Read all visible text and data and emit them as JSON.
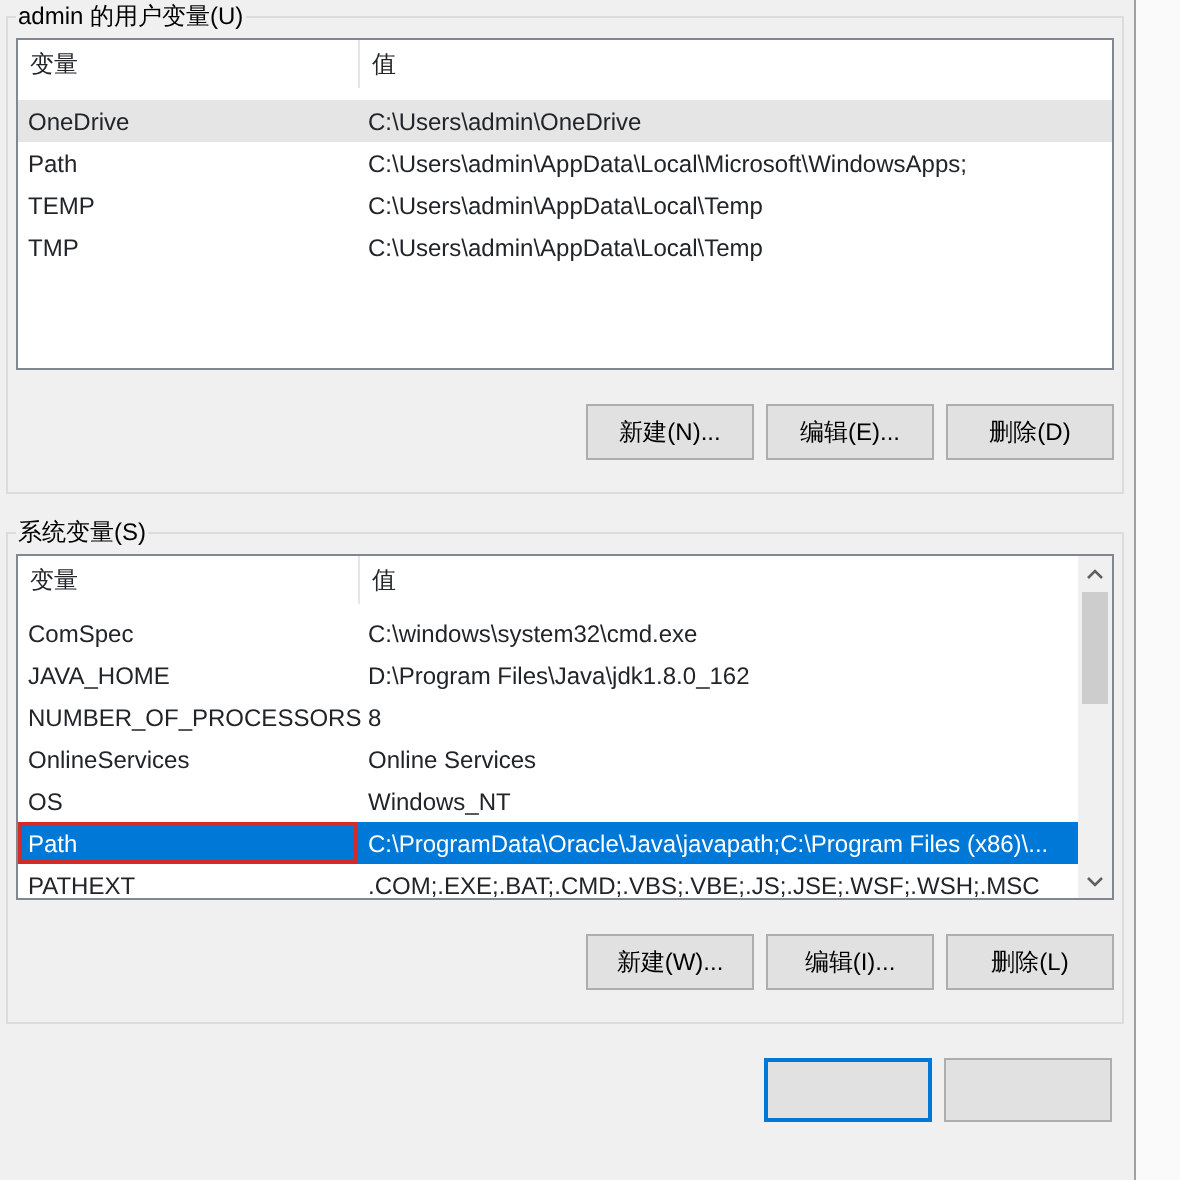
{
  "user_variables": {
    "title": "admin 的用户变量(U)",
    "columns": [
      "变量",
      "值"
    ],
    "rows": [
      {
        "name": "OneDrive",
        "value": "C:\\Users\\admin\\OneDrive",
        "selected": false,
        "hovered": true,
        "highlighted": false
      },
      {
        "name": "Path",
        "value": "C:\\Users\\admin\\AppData\\Local\\Microsoft\\WindowsApps;",
        "selected": false,
        "hovered": false,
        "highlighted": false
      },
      {
        "name": "TEMP",
        "value": "C:\\Users\\admin\\AppData\\Local\\Temp",
        "selected": false,
        "hovered": false,
        "highlighted": false
      },
      {
        "name": "TMP",
        "value": "C:\\Users\\admin\\AppData\\Local\\Temp",
        "selected": false,
        "hovered": false,
        "highlighted": false
      }
    ],
    "buttons": [
      "新建(N)...",
      "编辑(E)...",
      "删除(D)"
    ]
  },
  "system_variables": {
    "title": "系统变量(S)",
    "columns": [
      "变量",
      "值"
    ],
    "rows": [
      {
        "name": "ComSpec",
        "value": "C:\\windows\\system32\\cmd.exe",
        "selected": false,
        "hovered": false,
        "highlighted": false
      },
      {
        "name": "JAVA_HOME",
        "value": "D:\\Program Files\\Java\\jdk1.8.0_162",
        "selected": false,
        "hovered": false,
        "highlighted": false
      },
      {
        "name": "NUMBER_OF_PROCESSORS",
        "value": "8",
        "selected": false,
        "hovered": false,
        "highlighted": false
      },
      {
        "name": "OnlineServices",
        "value": "Online Services",
        "selected": false,
        "hovered": false,
        "highlighted": false
      },
      {
        "name": "OS",
        "value": "Windows_NT",
        "selected": false,
        "hovered": false,
        "highlighted": false
      },
      {
        "name": "Path",
        "value": "C:\\ProgramData\\Oracle\\Java\\javapath;C:\\Program Files (x86)\\...",
        "selected": true,
        "hovered": false,
        "highlighted": true
      },
      {
        "name": "PATHEXT",
        "value": ".COM;.EXE;.BAT;.CMD;.VBS;.VBE;.JS;.JSE;.WSF;.WSH;.MSC",
        "selected": false,
        "hovered": false,
        "highlighted": false
      }
    ],
    "buttons": [
      "新建(W)...",
      "编辑(I)...",
      "删除(L)"
    ]
  },
  "footer_buttons": [
    {
      "default": true
    },
    {
      "default": false
    }
  ]
}
